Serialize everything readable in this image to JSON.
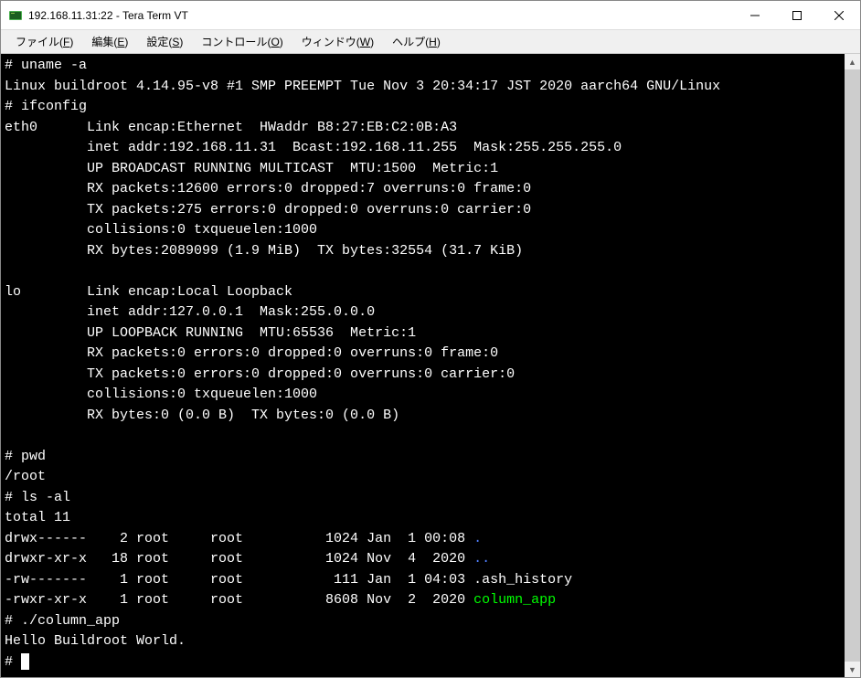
{
  "titlebar": {
    "title": "192.168.11.31:22 - Tera Term VT"
  },
  "menubar": {
    "file": "ファイル",
    "file_key": "F",
    "edit": "編集",
    "edit_key": "E",
    "setup": "設定",
    "setup_key": "S",
    "control": "コントロール",
    "control_key": "O",
    "window": "ウィンドウ",
    "window_key": "W",
    "help": "ヘルプ",
    "help_key": "H"
  },
  "terminal": {
    "lines": [
      {
        "t": "# uname -a"
      },
      {
        "t": "Linux buildroot 4.14.95-v8 #1 SMP PREEMPT Tue Nov 3 20:34:17 JST 2020 aarch64 GNU/Linux"
      },
      {
        "t": "# ifconfig"
      },
      {
        "t": "eth0      Link encap:Ethernet  HWaddr B8:27:EB:C2:0B:A3"
      },
      {
        "t": "          inet addr:192.168.11.31  Bcast:192.168.11.255  Mask:255.255.255.0"
      },
      {
        "t": "          UP BROADCAST RUNNING MULTICAST  MTU:1500  Metric:1"
      },
      {
        "t": "          RX packets:12600 errors:0 dropped:7 overruns:0 frame:0"
      },
      {
        "t": "          TX packets:275 errors:0 dropped:0 overruns:0 carrier:0"
      },
      {
        "t": "          collisions:0 txqueuelen:1000"
      },
      {
        "t": "          RX bytes:2089099 (1.9 MiB)  TX bytes:32554 (31.7 KiB)"
      },
      {
        "t": ""
      },
      {
        "t": "lo        Link encap:Local Loopback"
      },
      {
        "t": "          inet addr:127.0.0.1  Mask:255.0.0.0"
      },
      {
        "t": "          UP LOOPBACK RUNNING  MTU:65536  Metric:1"
      },
      {
        "t": "          RX packets:0 errors:0 dropped:0 overruns:0 frame:0"
      },
      {
        "t": "          TX packets:0 errors:0 dropped:0 overruns:0 carrier:0"
      },
      {
        "t": "          collisions:0 txqueuelen:1000"
      },
      {
        "t": "          RX bytes:0 (0.0 B)  TX bytes:0 (0.0 B)"
      },
      {
        "t": ""
      },
      {
        "t": "# pwd"
      },
      {
        "t": "/root"
      },
      {
        "t": "# ls -al"
      },
      {
        "t": "total 11"
      },
      {
        "segments": [
          {
            "t": "drwx------    2 root     root          1024 Jan  1 00:08 "
          },
          {
            "t": ".",
            "cls": "dir-blue"
          }
        ]
      },
      {
        "segments": [
          {
            "t": "drwxr-xr-x   18 root     root          1024 Nov  4  2020 "
          },
          {
            "t": "..",
            "cls": "dir-blue"
          }
        ]
      },
      {
        "t": "-rw-------    1 root     root           111 Jan  1 04:03 .ash_history"
      },
      {
        "segments": [
          {
            "t": "-rwxr-xr-x    1 root     root          8608 Nov  2  2020 "
          },
          {
            "t": "column_app",
            "cls": "exec-green"
          }
        ]
      },
      {
        "t": "# ./column_app"
      },
      {
        "t": "Hello Buildroot World."
      },
      {
        "prompt": true,
        "t": "# "
      }
    ]
  }
}
